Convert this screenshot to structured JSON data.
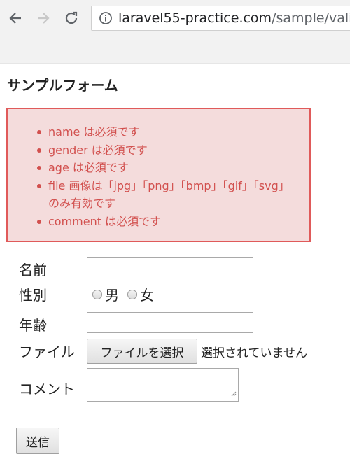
{
  "browser": {
    "url_host": "laravel55-practice.com",
    "url_path": "/sample/vali"
  },
  "page": {
    "title": "サンプルフォーム"
  },
  "errors": [
    "name は必須です",
    "gender は必須です",
    "age は必須です",
    "file 画像は「jpg」「png」「bmp」「gif」「svg」のみ有効です",
    "comment は必須です"
  ],
  "form": {
    "name_label": "名前",
    "gender_label": "性別",
    "gender_options": [
      "男",
      "女"
    ],
    "age_label": "年齢",
    "file_label": "ファイル",
    "file_button_label": "ファイルを選択",
    "file_status": "選択されていません",
    "comment_label": "コメント",
    "submit_label": "送信"
  },
  "colors": {
    "error_text": "#d2504e",
    "error_border": "#e05a5a",
    "error_bg": "#f4dcdc"
  }
}
